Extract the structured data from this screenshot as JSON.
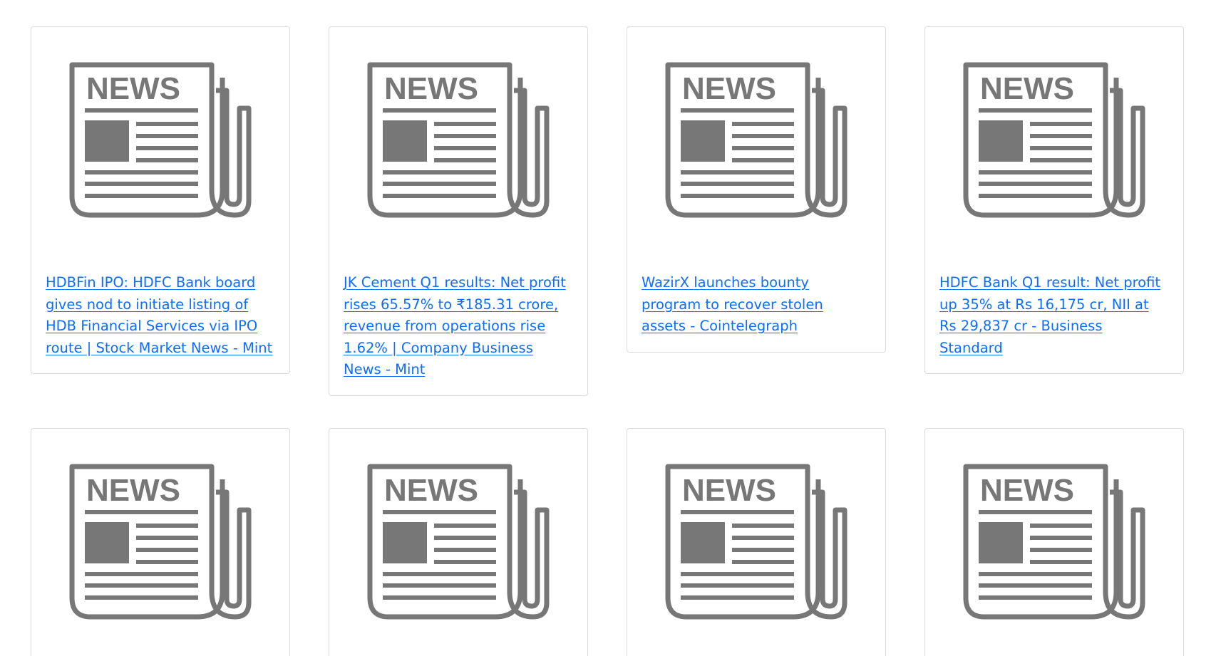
{
  "icon": {
    "name": "newspaper-icon",
    "word": "NEWS",
    "color": "#777777"
  },
  "link_color": "#0d6efd",
  "articles": [
    {
      "title": "HDBFin IPO: HDFC Bank board gives nod to initiate listing of HDB Financial Services via IPO route | Stock Market News - Mint"
    },
    {
      "title": "JK Cement Q1 results: Net profit rises 65.57% to ₹185.31 crore, revenue from operations rise 1.62% | Company Business News - Mint"
    },
    {
      "title": "WazirX launches bounty program to recover stolen assets - Cointelegraph"
    },
    {
      "title": "HDFC Bank Q1 result: Net profit up 35% at Rs 16,175 cr, NII at Rs 29,837 cr - Business Standard"
    }
  ]
}
